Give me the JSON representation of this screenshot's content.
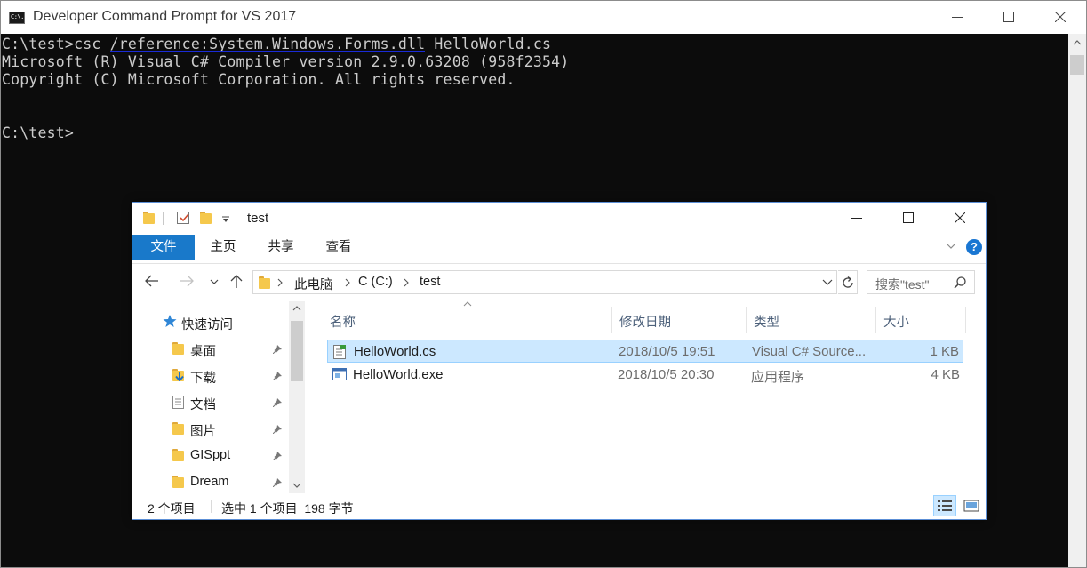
{
  "console": {
    "title": "Developer Command Prompt for VS 2017",
    "icon_label": "C:\\.",
    "lines": {
      "line1_prompt": "C:\\test>csc ",
      "line1_highlight": "/reference:System.Windows.Forms.dll",
      "line1_rest": " HelloWorld.cs",
      "line2": "Microsoft (R) Visual C# Compiler version 2.9.0.63208 (958f2354)",
      "line3": "Copyright (C) Microsoft Corporation. All rights reserved.",
      "line4": "C:\\test>"
    },
    "highlight_color": "#1a2bd6"
  },
  "explorer": {
    "title": "test",
    "ribbon": {
      "tabs": [
        "文件",
        "主页",
        "共享",
        "查看"
      ],
      "help": "?"
    },
    "address": {
      "crumbs": [
        "此电脑",
        "C (C:)",
        "test"
      ]
    },
    "search": {
      "placeholder": "搜索\"test\""
    },
    "nav": {
      "quick_access": "快速访问",
      "items": [
        "桌面",
        "下载",
        "文档",
        "图片",
        "GISppt",
        "Dream"
      ]
    },
    "columns": [
      "名称",
      "修改日期",
      "类型",
      "大小"
    ],
    "files": [
      {
        "name": "HelloWorld.cs",
        "date": "2018/10/5 19:51",
        "type": "Visual C# Source...",
        "size": "1 KB"
      },
      {
        "name": "HelloWorld.exe",
        "date": "2018/10/5 20:30",
        "type": "应用程序",
        "size": "4 KB"
      }
    ],
    "status": {
      "count": "2 个项目",
      "selected": "选中 1 个项目  198 字节"
    },
    "colors": {
      "accent": "#1979ca",
      "selection": "#cce8ff",
      "folder": "#f5c84c"
    }
  }
}
